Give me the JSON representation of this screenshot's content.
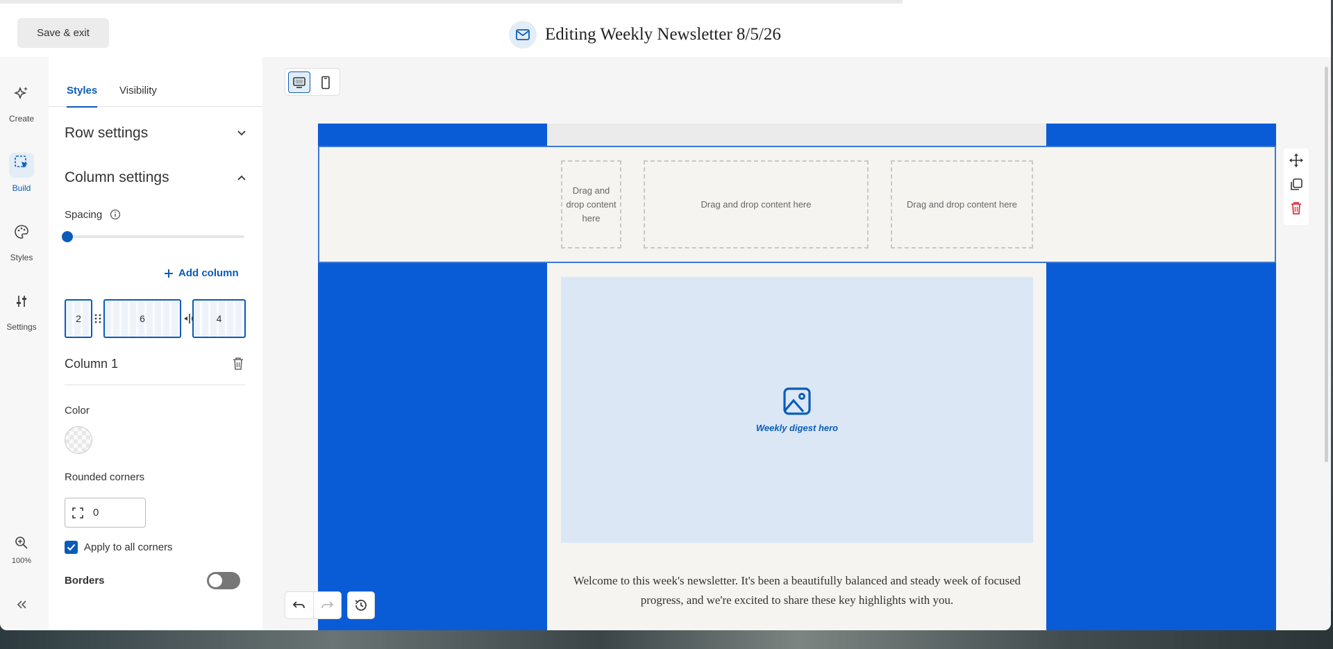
{
  "header": {
    "save_label": "Save & exit",
    "title": "Editing Weekly Newsletter 8/5/26"
  },
  "rail": {
    "items": [
      {
        "label": "Create",
        "icon": "sparkle-icon"
      },
      {
        "label": "Build",
        "icon": "build-icon",
        "active": true
      },
      {
        "label": "Styles",
        "icon": "palette-icon"
      },
      {
        "label": "Settings",
        "icon": "sliders-icon"
      }
    ],
    "zoom": "100%"
  },
  "panel": {
    "tabs": [
      {
        "label": "Styles",
        "active": true
      },
      {
        "label": "Visibility"
      }
    ],
    "row_settings": "Row settings",
    "column_settings": "Column settings",
    "spacing_label": "Spacing",
    "spacing_value_fraction": 0.0,
    "add_column": "Add column",
    "columns": [
      "2",
      "6",
      "4"
    ],
    "column_title": "Column 1",
    "color_label": "Color",
    "rounded_label": "Rounded corners",
    "rounded_value": "0",
    "apply_all_label": "Apply to all corners",
    "apply_all_checked": true,
    "borders_label": "Borders",
    "borders_on": false
  },
  "canvas": {
    "drop_text_narrow": "Drag and drop content here",
    "drop_text_mid": "Drag and drop content here",
    "drop_text_right": "Drag and drop content here",
    "hero_caption": "Weekly digest hero",
    "intro_text": "Welcome to this week's newsletter. It's been a beautifully balanced and steady week of focused progress, and we're excited to share these key highlights with you."
  },
  "colors": {
    "accent": "#0a5cb8",
    "email_bg": "#0a5cd6",
    "delete": "#d9363e"
  }
}
